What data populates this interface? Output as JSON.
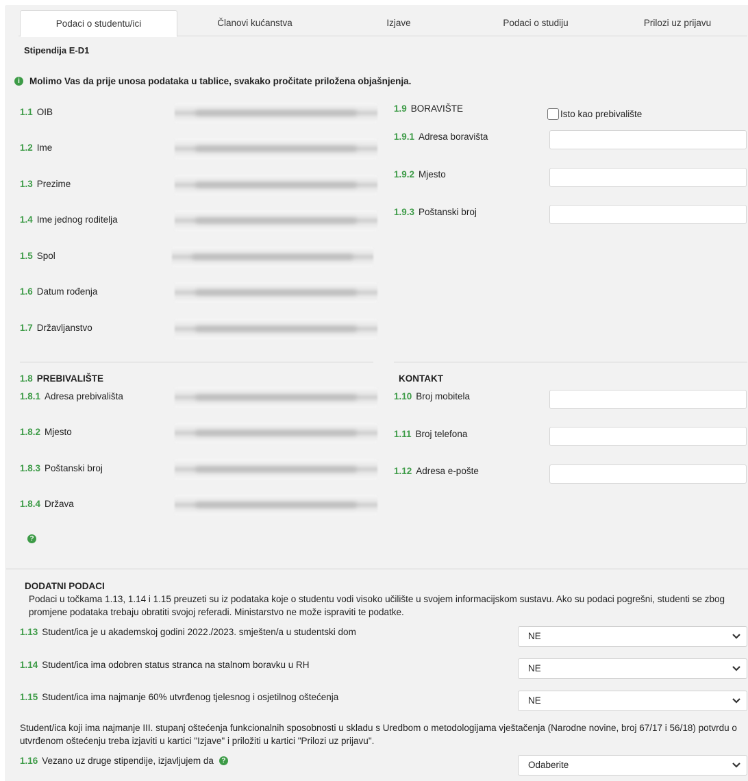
{
  "tabs": [
    {
      "label": "Podaci o studentu/ici",
      "active": true
    },
    {
      "label": "Članovi kućanstva"
    },
    {
      "label": "Izjave"
    },
    {
      "label": "Podaci o studiju"
    },
    {
      "label": "Prilozi uz prijavu"
    }
  ],
  "form_title": "Stipendija E-D1",
  "info_text": "Molimo Vas da prije unosa podataka u tablice, svakako pročitate priložena objašnjenja.",
  "personal": [
    {
      "num": "1.1",
      "label": "OIB"
    },
    {
      "num": "1.2",
      "label": "Ime"
    },
    {
      "num": "1.3",
      "label": "Prezime"
    },
    {
      "num": "1.4",
      "label": "Ime jednog roditelja"
    },
    {
      "num": "1.5",
      "label": "Spol"
    },
    {
      "num": "1.6",
      "label": "Datum rođenja"
    },
    {
      "num": "1.7",
      "label": "Državljanstvo"
    }
  ],
  "boraviste": {
    "num": "1.9",
    "title": "BORAVIŠTE",
    "checkbox_label": "Isto kao prebivalište",
    "fields": [
      {
        "num": "1.9.1",
        "label": "Adresa boravišta"
      },
      {
        "num": "1.9.2",
        "label": "Mjesto"
      },
      {
        "num": "1.9.3",
        "label": "Poštanski broj"
      }
    ]
  },
  "prebivaliste": {
    "num": "1.8",
    "title": "PREBIVALIŠTE",
    "fields": [
      {
        "num": "1.8.1",
        "label": "Adresa prebivališta"
      },
      {
        "num": "1.8.2",
        "label": "Mjesto"
      },
      {
        "num": "1.8.3",
        "label": "Poštanski broj"
      },
      {
        "num": "1.8.4",
        "label": "Država"
      }
    ]
  },
  "kontakt": {
    "title": "KONTAKT",
    "fields": [
      {
        "num": "1.10",
        "label": "Broj mobitela"
      },
      {
        "num": "1.11",
        "label": "Broj telefona"
      },
      {
        "num": "1.12",
        "label": "Adresa e-pošte"
      }
    ]
  },
  "icons": {
    "info": "info-icon",
    "help": "help-icon",
    "chevron": "chevron-down-icon"
  },
  "colors": {
    "accent": "#3d9b47"
  },
  "dodatni": {
    "title": "DODATNI PODACI",
    "intro_line1": "Podaci u točkama 1.13, 1.14 i 1.15 preuzeti su iz podataka koje o studentu vodi visoko učilište u svojem informacijskom sustavu. Ako su podaci pogrešni, studenti se zbog",
    "intro_line2": "promjene podataka trebaju obratiti svojoj referadi. Ministarstvo ne može ispraviti te podatke.",
    "questions": [
      {
        "num": "1.13",
        "label": "Student/ica je u akademskoj godini 2022./2023. smješten/a u studentski dom",
        "value": "NE"
      },
      {
        "num": "1.14",
        "label": "Student/ica ima odobren status stranca na stalnom boravku u RH",
        "value": "NE"
      },
      {
        "num": "1.15",
        "label": "Student/ica ima najmanje 60% utvrđenog tjelesnog i osjetilnog oštećenja",
        "value": "NE"
      }
    ],
    "note_line1": "Student/ica koji ima najmanje III. stupanj oštećenja funkcionalnih sposobnosti u skladu s Uredbom o metodologijama vještačenja (Narodne novine, broj 67/17 i 56/18) potvrdu o",
    "note_line2": "utvrđenom oštećenju treba izjaviti u kartici \"Izjave\" i priložiti u kartici \"Prilozi uz prijavu\".",
    "q16": {
      "num": "1.16",
      "label": "Vezano uz druge stipendije, izjavljujem da",
      "value": "Odaberite"
    }
  }
}
